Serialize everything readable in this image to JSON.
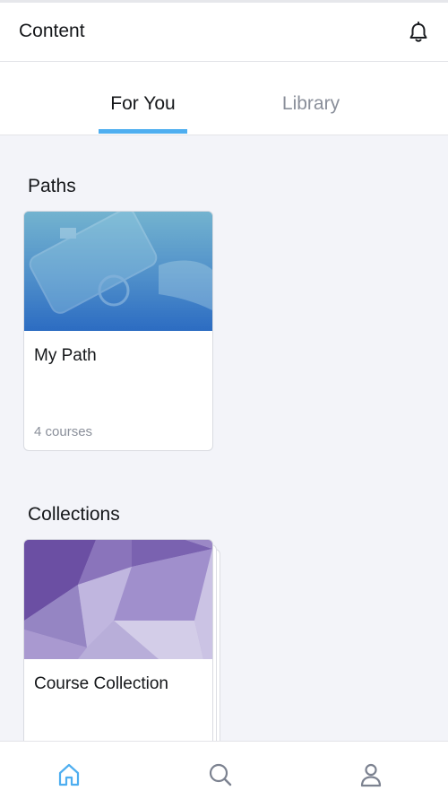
{
  "header": {
    "title": "Content",
    "notification_icon": "bell-icon"
  },
  "tabs": [
    {
      "label": "For You",
      "active": true
    },
    {
      "label": "Library",
      "active": false
    }
  ],
  "sections": {
    "paths": {
      "title": "Paths",
      "cards": [
        {
          "title": "My Path",
          "meta": "4 courses"
        }
      ]
    },
    "collections": {
      "title": "Collections",
      "cards": [
        {
          "title": "Course Collection"
        }
      ]
    }
  },
  "bottom_nav": [
    {
      "icon": "home-icon",
      "active": true
    },
    {
      "icon": "search-icon",
      "active": false
    },
    {
      "icon": "profile-icon",
      "active": false
    }
  ],
  "colors": {
    "accent": "#4eaef0",
    "background": "#f3f4f9",
    "text_muted": "#8a8f9a"
  }
}
